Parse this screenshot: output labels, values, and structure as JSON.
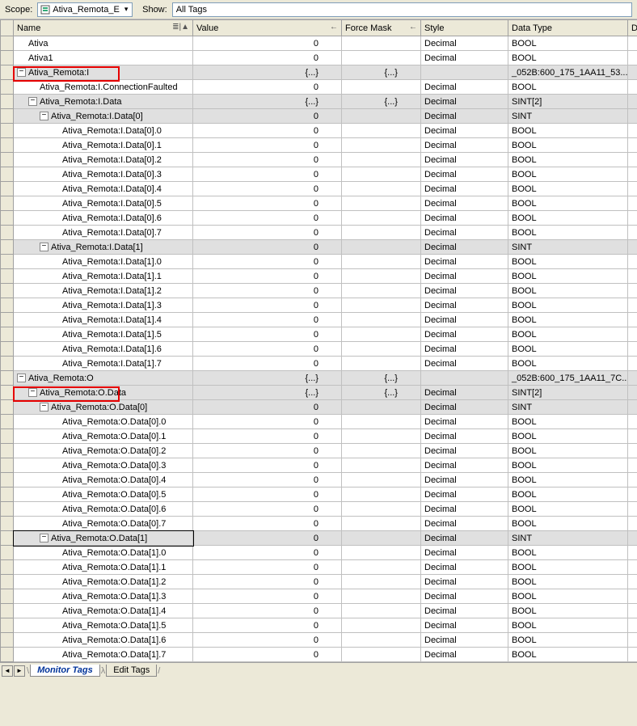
{
  "toolbar": {
    "scope_label": "Scope:",
    "scope_value": "Ativa_Remota_E",
    "show_label": "Show:",
    "show_value": "All Tags"
  },
  "columns": {
    "name": "Name",
    "value": "Value",
    "force": "Force Mask",
    "style": "Style",
    "datatype": "Data Type",
    "extra": "D"
  },
  "rows": [
    {
      "indent": 0,
      "exp": null,
      "name": "Ativa",
      "value": "0",
      "force": "",
      "style": "Decimal",
      "dtype": "BOOL",
      "shaded": false
    },
    {
      "indent": 0,
      "exp": null,
      "name": "Ativa1",
      "value": "0",
      "force": "",
      "style": "Decimal",
      "dtype": "BOOL",
      "shaded": false
    },
    {
      "indent": 0,
      "exp": "-",
      "name": "Ativa_Remota:I",
      "value": "{...}",
      "force": "{...}",
      "style": "",
      "dtype": "_052B:600_175_1AA11_53...",
      "shaded": true
    },
    {
      "indent": 1,
      "exp": null,
      "name": "Ativa_Remota:I.ConnectionFaulted",
      "value": "0",
      "force": "",
      "style": "Decimal",
      "dtype": "BOOL",
      "shaded": false
    },
    {
      "indent": 1,
      "exp": "-",
      "name": "Ativa_Remota:I.Data",
      "value": "{...}",
      "force": "{...}",
      "style": "Decimal",
      "dtype": "SINT[2]",
      "shaded": true
    },
    {
      "indent": 2,
      "exp": "-",
      "name": "Ativa_Remota:I.Data[0]",
      "value": "0",
      "force": "",
      "style": "Decimal",
      "dtype": "SINT",
      "shaded": true
    },
    {
      "indent": 3,
      "exp": null,
      "name": "Ativa_Remota:I.Data[0].0",
      "value": "0",
      "force": "",
      "style": "Decimal",
      "dtype": "BOOL",
      "shaded": false
    },
    {
      "indent": 3,
      "exp": null,
      "name": "Ativa_Remota:I.Data[0].1",
      "value": "0",
      "force": "",
      "style": "Decimal",
      "dtype": "BOOL",
      "shaded": false
    },
    {
      "indent": 3,
      "exp": null,
      "name": "Ativa_Remota:I.Data[0].2",
      "value": "0",
      "force": "",
      "style": "Decimal",
      "dtype": "BOOL",
      "shaded": false
    },
    {
      "indent": 3,
      "exp": null,
      "name": "Ativa_Remota:I.Data[0].3",
      "value": "0",
      "force": "",
      "style": "Decimal",
      "dtype": "BOOL",
      "shaded": false
    },
    {
      "indent": 3,
      "exp": null,
      "name": "Ativa_Remota:I.Data[0].4",
      "value": "0",
      "force": "",
      "style": "Decimal",
      "dtype": "BOOL",
      "shaded": false
    },
    {
      "indent": 3,
      "exp": null,
      "name": "Ativa_Remota:I.Data[0].5",
      "value": "0",
      "force": "",
      "style": "Decimal",
      "dtype": "BOOL",
      "shaded": false
    },
    {
      "indent": 3,
      "exp": null,
      "name": "Ativa_Remota:I.Data[0].6",
      "value": "0",
      "force": "",
      "style": "Decimal",
      "dtype": "BOOL",
      "shaded": false
    },
    {
      "indent": 3,
      "exp": null,
      "name": "Ativa_Remota:I.Data[0].7",
      "value": "0",
      "force": "",
      "style": "Decimal",
      "dtype": "BOOL",
      "shaded": false
    },
    {
      "indent": 2,
      "exp": "-",
      "name": "Ativa_Remota:I.Data[1]",
      "value": "0",
      "force": "",
      "style": "Decimal",
      "dtype": "SINT",
      "shaded": true
    },
    {
      "indent": 3,
      "exp": null,
      "name": "Ativa_Remota:I.Data[1].0",
      "value": "0",
      "force": "",
      "style": "Decimal",
      "dtype": "BOOL",
      "shaded": false
    },
    {
      "indent": 3,
      "exp": null,
      "name": "Ativa_Remota:I.Data[1].1",
      "value": "0",
      "force": "",
      "style": "Decimal",
      "dtype": "BOOL",
      "shaded": false
    },
    {
      "indent": 3,
      "exp": null,
      "name": "Ativa_Remota:I.Data[1].2",
      "value": "0",
      "force": "",
      "style": "Decimal",
      "dtype": "BOOL",
      "shaded": false
    },
    {
      "indent": 3,
      "exp": null,
      "name": "Ativa_Remota:I.Data[1].3",
      "value": "0",
      "force": "",
      "style": "Decimal",
      "dtype": "BOOL",
      "shaded": false
    },
    {
      "indent": 3,
      "exp": null,
      "name": "Ativa_Remota:I.Data[1].4",
      "value": "0",
      "force": "",
      "style": "Decimal",
      "dtype": "BOOL",
      "shaded": false
    },
    {
      "indent": 3,
      "exp": null,
      "name": "Ativa_Remota:I.Data[1].5",
      "value": "0",
      "force": "",
      "style": "Decimal",
      "dtype": "BOOL",
      "shaded": false
    },
    {
      "indent": 3,
      "exp": null,
      "name": "Ativa_Remota:I.Data[1].6",
      "value": "0",
      "force": "",
      "style": "Decimal",
      "dtype": "BOOL",
      "shaded": false
    },
    {
      "indent": 3,
      "exp": null,
      "name": "Ativa_Remota:I.Data[1].7",
      "value": "0",
      "force": "",
      "style": "Decimal",
      "dtype": "BOOL",
      "shaded": false
    },
    {
      "indent": 0,
      "exp": "-",
      "name": "Ativa_Remota:O",
      "value": "{...}",
      "force": "{...}",
      "style": "",
      "dtype": "_052B:600_175_1AA11_7C...",
      "shaded": true
    },
    {
      "indent": 1,
      "exp": "-",
      "name": "Ativa_Remota:O.Data",
      "value": "{...}",
      "force": "{...}",
      "style": "Decimal",
      "dtype": "SINT[2]",
      "shaded": true
    },
    {
      "indent": 2,
      "exp": "-",
      "name": "Ativa_Remota:O.Data[0]",
      "value": "0",
      "force": "",
      "style": "Decimal",
      "dtype": "SINT",
      "shaded": true
    },
    {
      "indent": 3,
      "exp": null,
      "name": "Ativa_Remota:O.Data[0].0",
      "value": "0",
      "force": "",
      "style": "Decimal",
      "dtype": "BOOL",
      "shaded": false
    },
    {
      "indent": 3,
      "exp": null,
      "name": "Ativa_Remota:O.Data[0].1",
      "value": "0",
      "force": "",
      "style": "Decimal",
      "dtype": "BOOL",
      "shaded": false
    },
    {
      "indent": 3,
      "exp": null,
      "name": "Ativa_Remota:O.Data[0].2",
      "value": "0",
      "force": "",
      "style": "Decimal",
      "dtype": "BOOL",
      "shaded": false
    },
    {
      "indent": 3,
      "exp": null,
      "name": "Ativa_Remota:O.Data[0].3",
      "value": "0",
      "force": "",
      "style": "Decimal",
      "dtype": "BOOL",
      "shaded": false
    },
    {
      "indent": 3,
      "exp": null,
      "name": "Ativa_Remota:O.Data[0].4",
      "value": "0",
      "force": "",
      "style": "Decimal",
      "dtype": "BOOL",
      "shaded": false
    },
    {
      "indent": 3,
      "exp": null,
      "name": "Ativa_Remota:O.Data[0].5",
      "value": "0",
      "force": "",
      "style": "Decimal",
      "dtype": "BOOL",
      "shaded": false
    },
    {
      "indent": 3,
      "exp": null,
      "name": "Ativa_Remota:O.Data[0].6",
      "value": "0",
      "force": "",
      "style": "Decimal",
      "dtype": "BOOL",
      "shaded": false
    },
    {
      "indent": 3,
      "exp": null,
      "name": "Ativa_Remota:O.Data[0].7",
      "value": "0",
      "force": "",
      "style": "Decimal",
      "dtype": "BOOL",
      "shaded": false
    },
    {
      "indent": 2,
      "exp": "-",
      "name": "Ativa_Remota:O.Data[1]",
      "value": "0",
      "force": "",
      "style": "Decimal",
      "dtype": "SINT",
      "shaded": true,
      "selected": true
    },
    {
      "indent": 3,
      "exp": null,
      "name": "Ativa_Remota:O.Data[1].0",
      "value": "0",
      "force": "",
      "style": "Decimal",
      "dtype": "BOOL",
      "shaded": false
    },
    {
      "indent": 3,
      "exp": null,
      "name": "Ativa_Remota:O.Data[1].1",
      "value": "0",
      "force": "",
      "style": "Decimal",
      "dtype": "BOOL",
      "shaded": false
    },
    {
      "indent": 3,
      "exp": null,
      "name": "Ativa_Remota:O.Data[1].2",
      "value": "0",
      "force": "",
      "style": "Decimal",
      "dtype": "BOOL",
      "shaded": false
    },
    {
      "indent": 3,
      "exp": null,
      "name": "Ativa_Remota:O.Data[1].3",
      "value": "0",
      "force": "",
      "style": "Decimal",
      "dtype": "BOOL",
      "shaded": false
    },
    {
      "indent": 3,
      "exp": null,
      "name": "Ativa_Remota:O.Data[1].4",
      "value": "0",
      "force": "",
      "style": "Decimal",
      "dtype": "BOOL",
      "shaded": false
    },
    {
      "indent": 3,
      "exp": null,
      "name": "Ativa_Remota:O.Data[1].5",
      "value": "0",
      "force": "",
      "style": "Decimal",
      "dtype": "BOOL",
      "shaded": false
    },
    {
      "indent": 3,
      "exp": null,
      "name": "Ativa_Remota:O.Data[1].6",
      "value": "0",
      "force": "",
      "style": "Decimal",
      "dtype": "BOOL",
      "shaded": false
    },
    {
      "indent": 3,
      "exp": null,
      "name": "Ativa_Remota:O.Data[1].7",
      "value": "0",
      "force": "",
      "style": "Decimal",
      "dtype": "BOOL",
      "shaded": false
    }
  ],
  "tabs": {
    "monitor": "Monitor Tags",
    "edit": "Edit Tags"
  }
}
